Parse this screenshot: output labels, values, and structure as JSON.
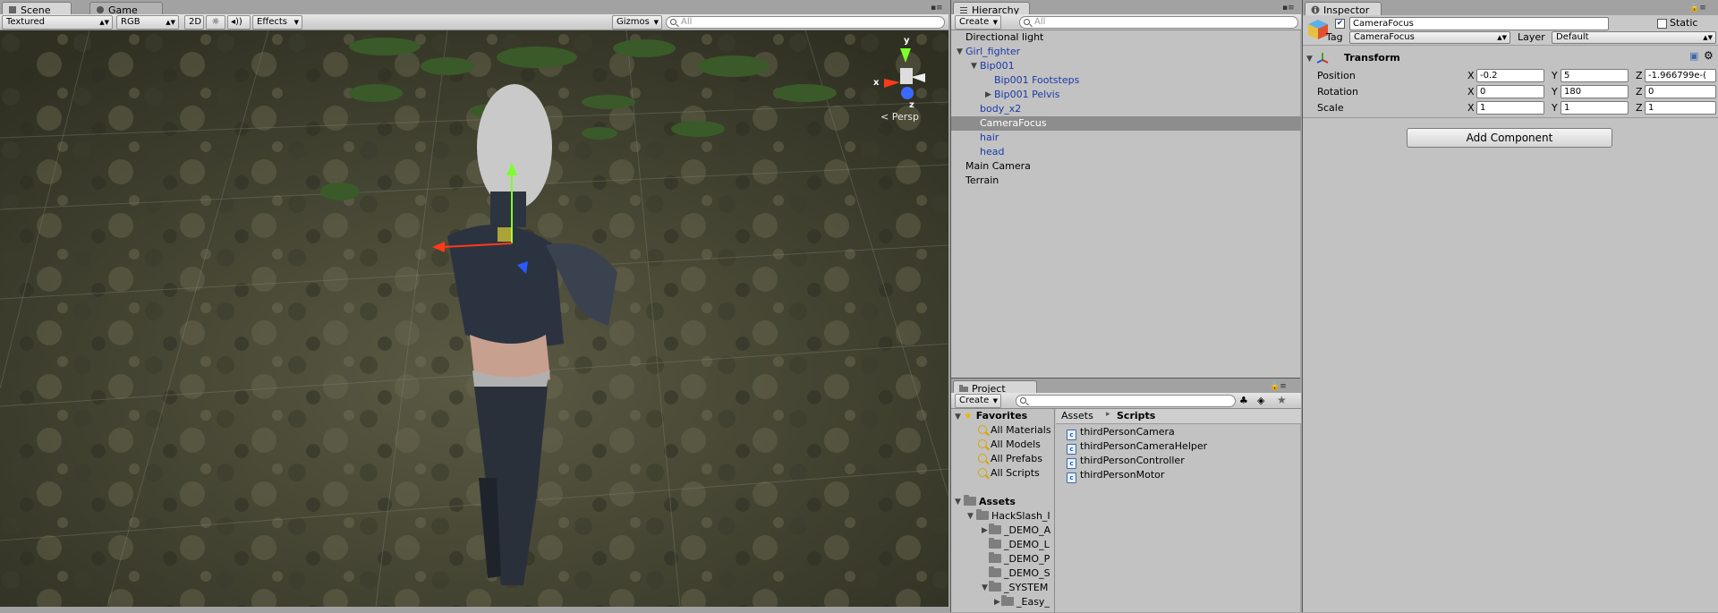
{
  "scene": {
    "tabs": [
      {
        "label": "Scene"
      },
      {
        "label": "Game"
      }
    ],
    "toolbar": {
      "render_mode": "Textured",
      "color_mode": "RGB",
      "mode_2d": "2D",
      "effects": "Effects",
      "gizmos": "Gizmos",
      "search_placeholder": "All"
    },
    "gizmo": {
      "y": "y",
      "x": "x",
      "z": "z",
      "projection": "< Persp"
    }
  },
  "hierarchy": {
    "title": "Hierarchy",
    "create": "Create",
    "search_placeholder": "All",
    "items": [
      {
        "label": "Directional light"
      },
      {
        "label": "Girl_fighter"
      },
      {
        "label": "Bip001"
      },
      {
        "label": "Bip001 Footsteps"
      },
      {
        "label": "Bip001 Pelvis"
      },
      {
        "label": "body_x2"
      },
      {
        "label": "CameraFocus"
      },
      {
        "label": "hair"
      },
      {
        "label": "head"
      },
      {
        "label": "Main Camera"
      },
      {
        "label": "Terrain"
      }
    ]
  },
  "project": {
    "title": "Project",
    "create": "Create",
    "favorites_label": "Favorites",
    "favorites": [
      {
        "label": "All Materials"
      },
      {
        "label": "All Models"
      },
      {
        "label": "All Prefabs"
      },
      {
        "label": "All Scripts"
      }
    ],
    "assets_label": "Assets",
    "tree": [
      {
        "label": "HackSlash_I"
      },
      {
        "label": "_DEMO_A"
      },
      {
        "label": "_DEMO_L"
      },
      {
        "label": "_DEMO_P"
      },
      {
        "label": "_DEMO_S"
      },
      {
        "label": "_SYSTEM"
      },
      {
        "label": "_Easy_"
      }
    ],
    "breadcrumb": {
      "root": "Assets",
      "separator": "▸",
      "current": "Scripts"
    },
    "files": [
      {
        "label": "thirdPersonCamera"
      },
      {
        "label": "thirdPersonCameraHelper"
      },
      {
        "label": "thirdPersonController"
      },
      {
        "label": "thirdPersonMotor"
      }
    ]
  },
  "inspector": {
    "title": "Inspector",
    "object_name": "CameraFocus",
    "static_label": "Static",
    "tag_label": "Tag",
    "tag_value": "CameraFocus",
    "layer_label": "Layer",
    "layer_value": "Default",
    "transform_title": "Transform",
    "position_label": "Position",
    "rotation_label": "Rotation",
    "scale_label": "Scale",
    "axis_x": "X",
    "axis_y": "Y",
    "axis_z": "Z",
    "position": {
      "x": "-0.2",
      "y": "5",
      "z": "-1.966799e-("
    },
    "rotation": {
      "x": "0",
      "y": "180",
      "z": "0"
    },
    "scale": {
      "x": "1",
      "y": "1",
      "z": "1"
    },
    "add_component": "Add Component"
  }
}
